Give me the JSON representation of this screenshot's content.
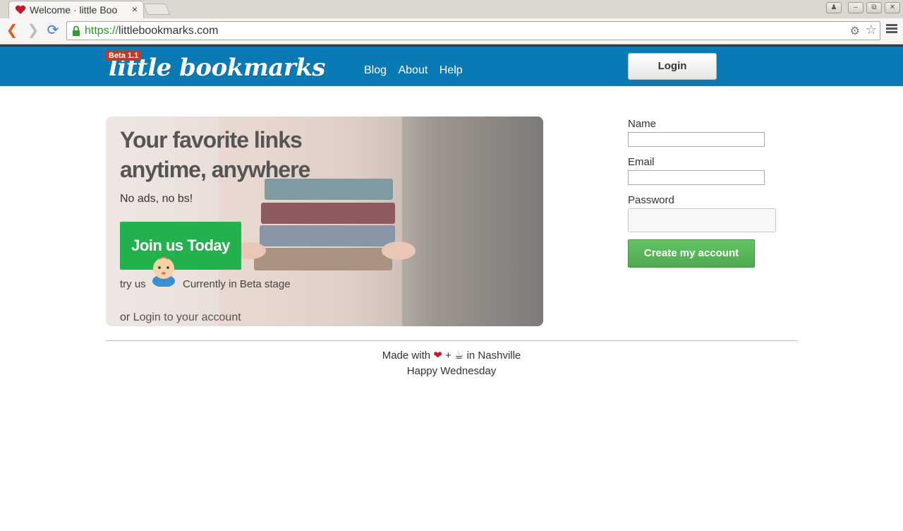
{
  "browser": {
    "tab_title": "Welcome · little Boo",
    "tab_close": "×",
    "url_scheme": "https://",
    "url_host": "littlebookmarks.com"
  },
  "header": {
    "beta_badge": "Beta 1.1",
    "logo_text": "little bookmarks",
    "nav": [
      "Blog",
      "About",
      "Help"
    ],
    "login_label": "Login",
    "bg_color": "#0a7ab5"
  },
  "hero": {
    "title_line1": "Your favorite links",
    "title_line2": "anytime, anywhere",
    "subtitle": "No ads, no bs!",
    "join_label": "Join us Today",
    "try_text": "try us",
    "beta_text": "Currently in Beta stage",
    "or_text": "or ",
    "login_link": "Login to your account",
    "join_color": "#22b14c"
  },
  "form": {
    "name_label": "Name",
    "email_label": "Email",
    "password_label": "Password",
    "submit_label": "Create my account"
  },
  "footer": {
    "made_with": "Made with",
    "plus": "+",
    "in_city": "in Nashville",
    "greeting": "Happy Wednesday"
  }
}
